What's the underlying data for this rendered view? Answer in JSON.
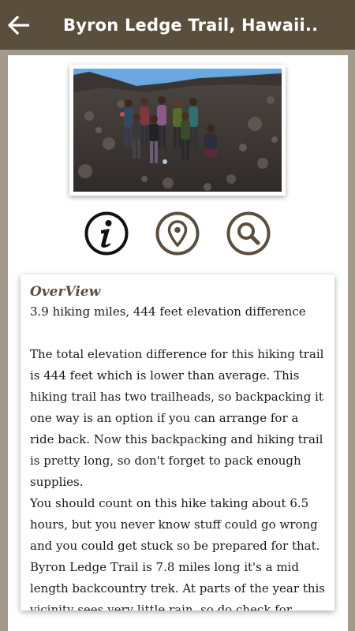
{
  "header": {
    "title": "Byron Ledge Trail, Hawaii..",
    "back_icon": "arrow-left-icon"
  },
  "colors": {
    "header_bg": "#5a4e3c",
    "accent": "#5a4e3c",
    "page_border": "#a39a8b"
  },
  "actions": [
    {
      "icon": "info-icon"
    },
    {
      "icon": "map-pin-icon"
    },
    {
      "icon": "search-icon"
    }
  ],
  "overview": {
    "heading": "OverView",
    "summary": "3.9 hiking miles, 444 feet elevation difference",
    "body": "The total elevation difference for this hiking trail is 444 feet which is lower than average. This hiking trail has two trailheads, so backpacking it one way is an option if you can arrange for a ride back. Now this backpacking and hiking trail is pretty long, so don't forget to pack enough supplies.\nYou should count on this hike taking about 6.5 hours, but you never know stuff could go wrong and you could get stuck so be prepared for that.\nByron Ledge Trail is 7.8 miles long it's a mid length backcountry trek. At parts of the year this vicinity sees very little rain, so do check for current fire"
  }
}
